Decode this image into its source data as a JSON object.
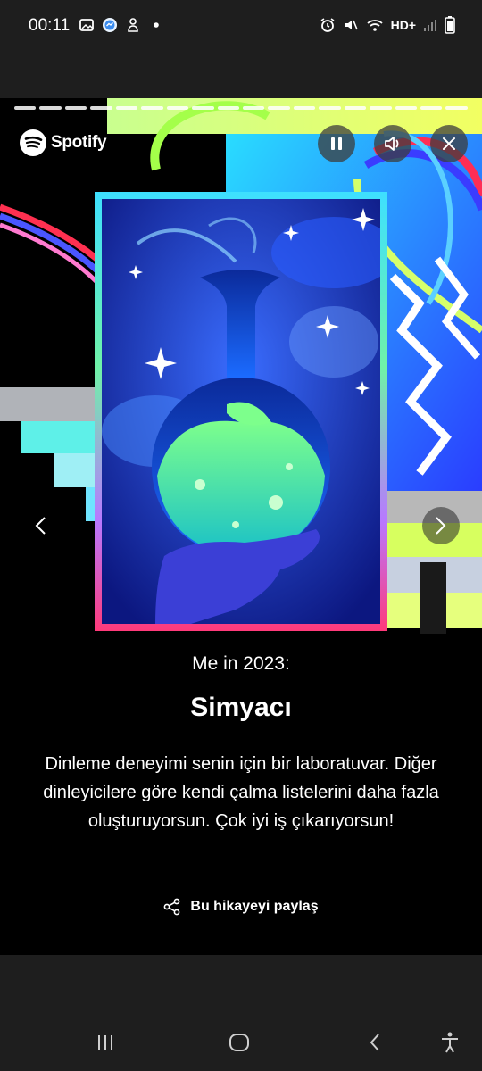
{
  "status_bar": {
    "time": "00:11",
    "network": "HD+",
    "left_icons": [
      "image-icon",
      "messenger-icon",
      "cleaner-icon",
      "dot-icon"
    ],
    "right_icons": [
      "alarm-icon",
      "mute-icon",
      "wifi-icon",
      "signal-icon",
      "battery-icon"
    ]
  },
  "story": {
    "brand": "Spotify",
    "progress_segments": 18,
    "controls": [
      "pause-icon",
      "volume-icon",
      "close-icon"
    ],
    "subtitle": "Me in 2023:",
    "title": "Simyacı",
    "description": "Dinleme deneyimi senin için bir laboratuvar. Diğer dinleyicilere göre kendi çalma listelerini daha fazla oluşturuyorsun. Çok iyi iş çıkarıyorsun!",
    "share_label": "Bu hikayeyi paylaş"
  },
  "nav_bar": {
    "buttons": [
      "recents-icon",
      "home-icon",
      "back-icon",
      "accessibility-icon"
    ]
  },
  "colors": {
    "background": "#000000",
    "system_bar": "#1e1e1e",
    "text": "#ffffff",
    "spotify_brand": "#ffffff"
  }
}
